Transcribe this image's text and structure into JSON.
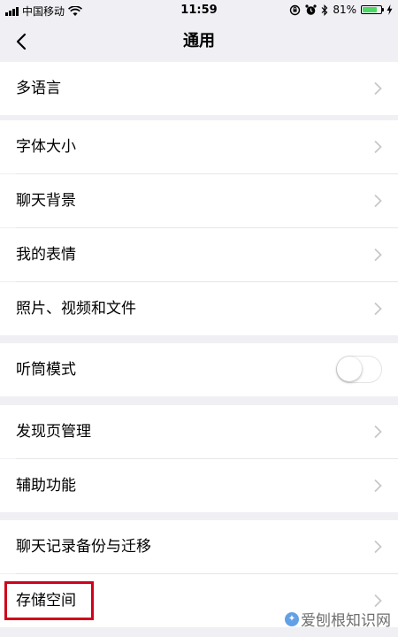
{
  "status_bar": {
    "carrier": "中国移动",
    "time": "11:59",
    "battery": "81%",
    "battery_level": 81,
    "icons": [
      "signal-bars-icon",
      "wifi-icon",
      "rotation-lock-icon",
      "alarm-icon",
      "bluetooth-icon",
      "battery-icon",
      "charging-bolt-icon"
    ]
  },
  "nav": {
    "title": "通用",
    "back_icon": "chevron-left-icon"
  },
  "groups": [
    {
      "rows": [
        {
          "label": "多语言",
          "accessory": "chevron"
        }
      ]
    },
    {
      "rows": [
        {
          "label": "字体大小",
          "accessory": "chevron"
        },
        {
          "label": "聊天背景",
          "accessory": "chevron"
        },
        {
          "label": "我的表情",
          "accessory": "chevron"
        },
        {
          "label": "照片、视频和文件",
          "accessory": "chevron"
        }
      ]
    },
    {
      "rows": [
        {
          "label": "听筒模式",
          "accessory": "toggle",
          "value": false
        }
      ]
    },
    {
      "rows": [
        {
          "label": "发现页管理",
          "accessory": "chevron"
        },
        {
          "label": "辅助功能",
          "accessory": "chevron"
        }
      ]
    },
    {
      "rows": [
        {
          "label": "聊天记录备份与迁移",
          "accessory": "chevron"
        },
        {
          "label": "存储空间",
          "accessory": "chevron",
          "highlighted": true
        }
      ]
    }
  ],
  "watermark": {
    "text": "爱刨根知识网"
  },
  "colors": {
    "background": "#efeff4",
    "highlight": "#d0021b",
    "battery": "#4cd964"
  }
}
